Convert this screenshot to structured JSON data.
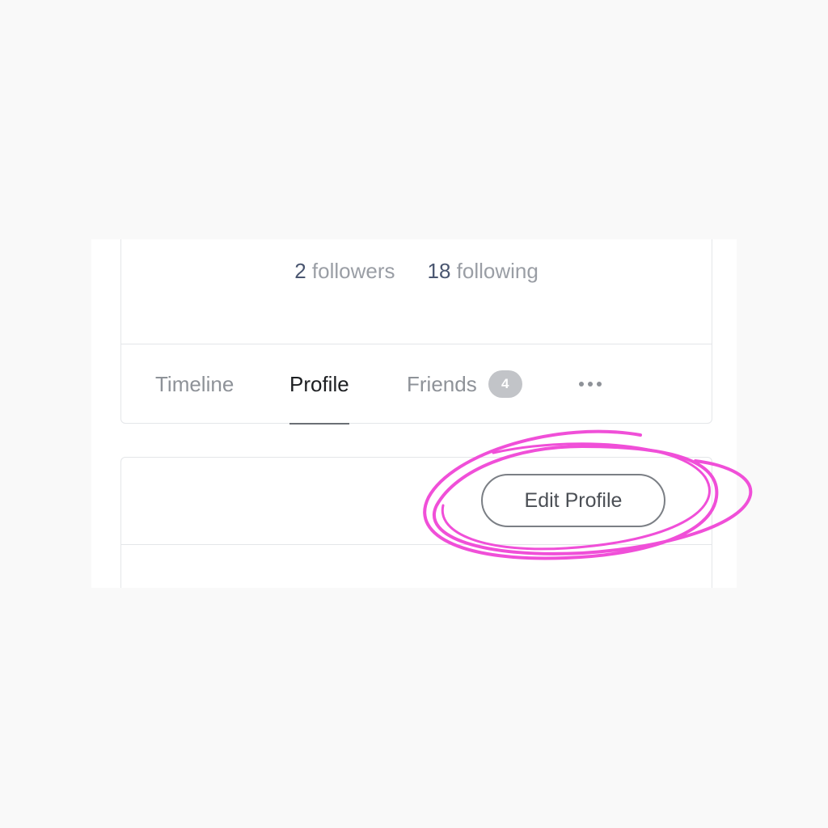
{
  "stats": {
    "followers_count": "2",
    "followers_label": "followers",
    "following_count": "18",
    "following_label": "following"
  },
  "tabs": [
    {
      "label": "Timeline",
      "active": false
    },
    {
      "label": "Profile",
      "active": true
    },
    {
      "label": "Friends",
      "active": false,
      "badge": "4"
    }
  ],
  "more_icon": "more-horizontal-icon",
  "actions": {
    "edit_profile_label": "Edit Profile"
  },
  "highlight": {
    "color": "#f04fd8",
    "target": "edit-profile-button"
  }
}
